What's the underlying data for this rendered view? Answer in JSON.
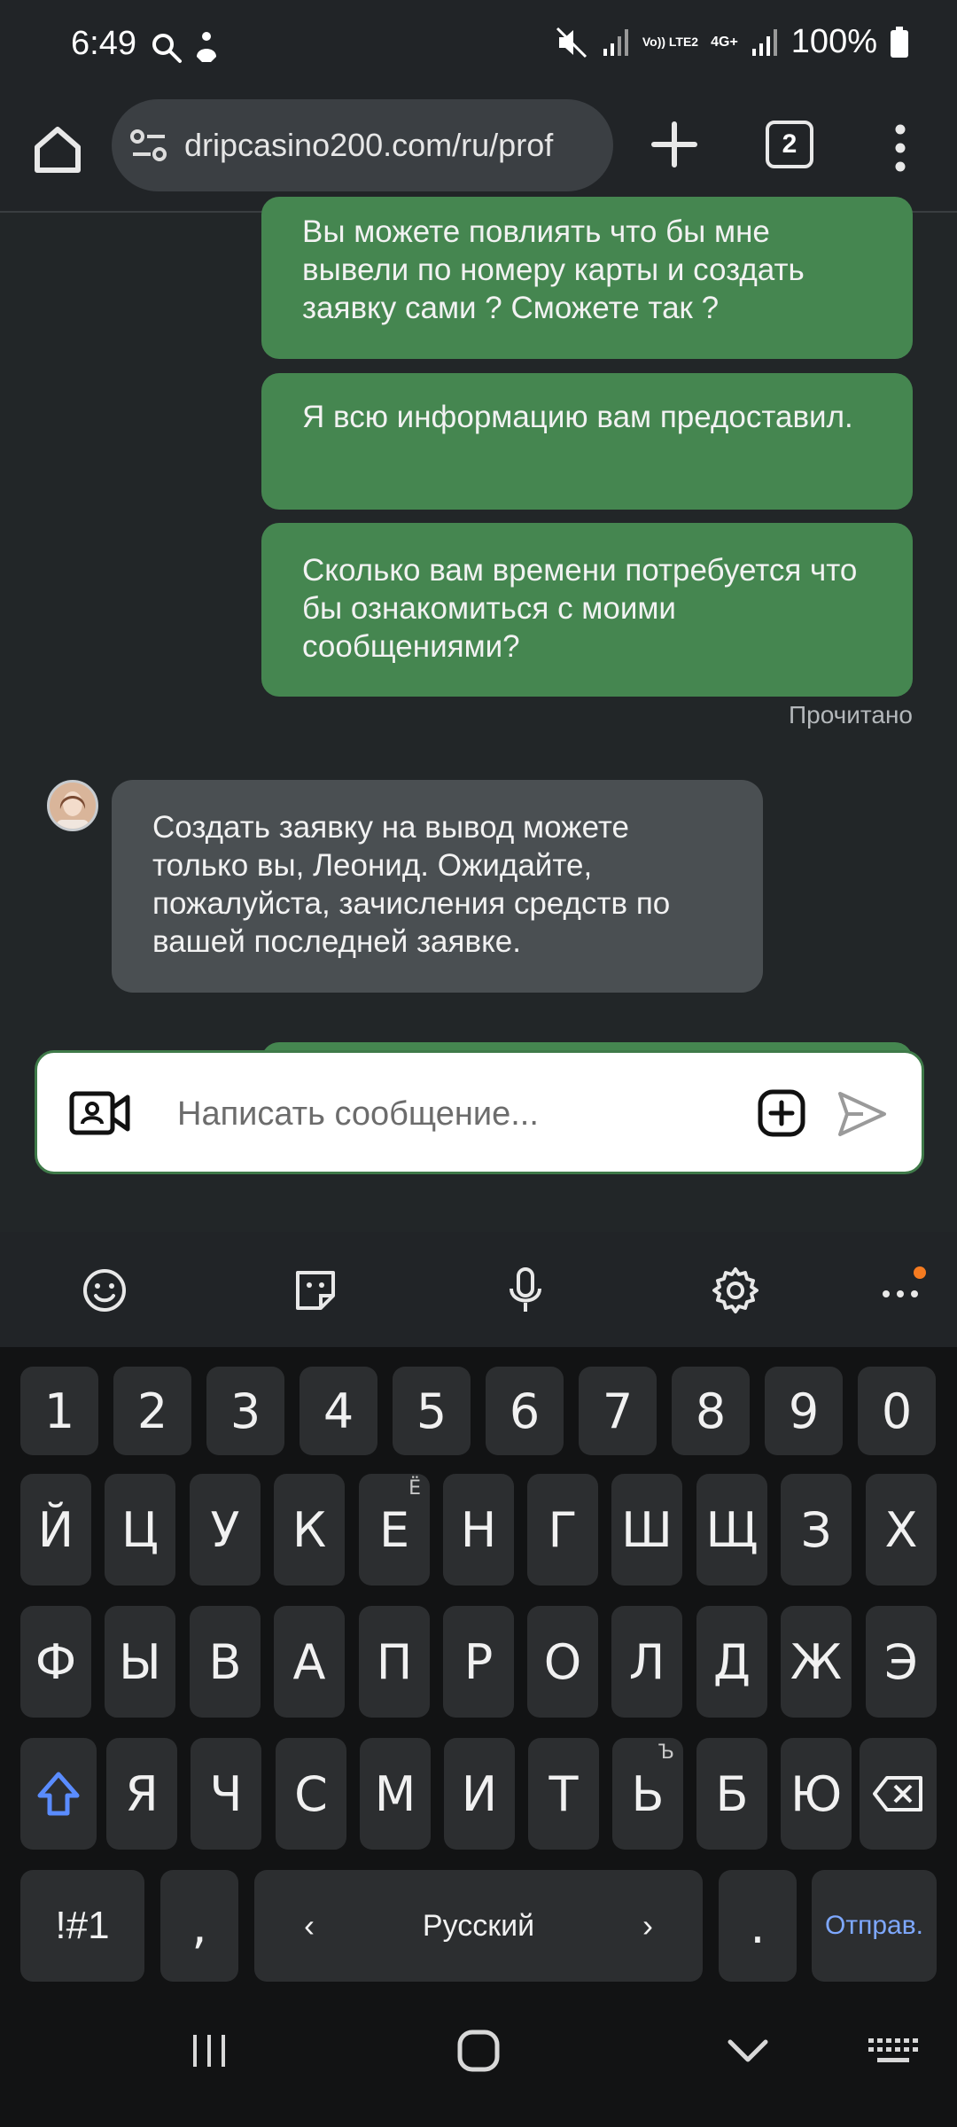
{
  "status_bar": {
    "time": "6:49",
    "battery_text": "100%",
    "network_volte": "Vo)) LTE2",
    "network_type": "4G+"
  },
  "browser": {
    "url": "dripcasino200.com/ru/prof",
    "tab_count": "2"
  },
  "chat": {
    "outgoing": [
      "Вы можете повлиять что бы мне вывели по номеру карты и создать заявку сами ? Сможете так ?",
      "Я всю информацию вам предоставил.",
      "Сколько вам времени потребуется что бы ознакомиться с моими сообщениями?"
    ],
    "read_status": "Прочитано",
    "incoming": "Создать заявку на вывод можете только вы, Леонид. Ожидайте, пожалуйста, зачисления средств по вашей последней заявке."
  },
  "composer": {
    "placeholder": "Написать сообщение..."
  },
  "keyboard": {
    "row_numbers": [
      "1",
      "2",
      "3",
      "4",
      "5",
      "6",
      "7",
      "8",
      "9",
      "0"
    ],
    "row1": [
      "Й",
      "Ц",
      "У",
      "К",
      "Е",
      "Н",
      "Г",
      "Ш",
      "Щ",
      "З",
      "Х"
    ],
    "row1_alt_e": "Ё",
    "row2": [
      "Ф",
      "Ы",
      "В",
      "А",
      "П",
      "Р",
      "О",
      "Л",
      "Д",
      "Ж",
      "Э"
    ],
    "row3": [
      "Я",
      "Ч",
      "С",
      "М",
      "И",
      "Т",
      "Ь",
      "Б",
      "Ю"
    ],
    "row3_alt_soft": "Ъ",
    "symbols_label": "!#1",
    "comma_label": ",",
    "space_label": "Русский",
    "period_label": ".",
    "send_label": "Отправ."
  },
  "colors": {
    "outgoing_bubble": "#458650",
    "incoming_bubble": "#4a4f52",
    "background": "#222628",
    "accent_blue": "#5a8cff",
    "notification_dot": "#f57b20"
  }
}
